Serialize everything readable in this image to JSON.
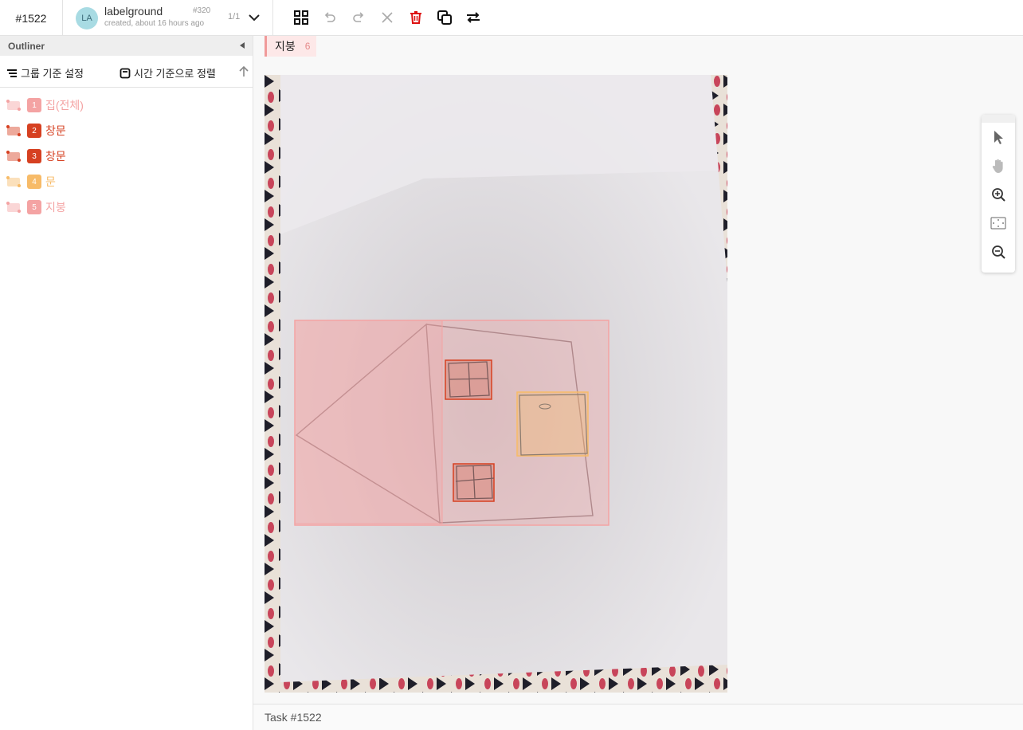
{
  "header": {
    "task_id": "#1522",
    "user": {
      "initials": "LA",
      "name": "labelground",
      "created": "created, about 16 hours ago",
      "number": "#320",
      "page": "1/1"
    },
    "tools": [
      {
        "name": "grid-icon",
        "enabled": true
      },
      {
        "name": "undo-icon",
        "enabled": false
      },
      {
        "name": "redo-icon",
        "enabled": false
      },
      {
        "name": "close-icon",
        "enabled": false
      },
      {
        "name": "trash-icon",
        "enabled": true
      },
      {
        "name": "copy-icon",
        "enabled": true
      },
      {
        "name": "swap-icon",
        "enabled": true
      }
    ]
  },
  "sidebar": {
    "title": "Outliner",
    "group_label": "그룹 기준 설정",
    "sort_label": "시간 기준으로 정렬",
    "items": [
      {
        "num": "1",
        "label": "집(전체)",
        "color": "#f4a3a3"
      },
      {
        "num": "2",
        "label": "창문",
        "color": "#d64021"
      },
      {
        "num": "3",
        "label": "창문",
        "color": "#d64021"
      },
      {
        "num": "4",
        "label": "문",
        "color": "#f7bb68"
      },
      {
        "num": "5",
        "label": "지붕",
        "color": "#f4a3a3"
      }
    ]
  },
  "canvas": {
    "category": "지붕",
    "category_count": "6",
    "annotations": [
      {
        "label": "집(전체)",
        "color": "#f4a3a3"
      },
      {
        "label": "지붕",
        "color": "#f4a3a3"
      },
      {
        "label": "창문",
        "color": "#d64021"
      },
      {
        "label": "창문",
        "color": "#d64021"
      },
      {
        "label": "문",
        "color": "#f7bb68"
      }
    ]
  },
  "footer": {
    "task": "Task #1522"
  },
  "zoom_tools": [
    "pointer-icon",
    "hand-icon",
    "zoom-in-icon",
    "fit-icon",
    "zoom-out-icon"
  ]
}
